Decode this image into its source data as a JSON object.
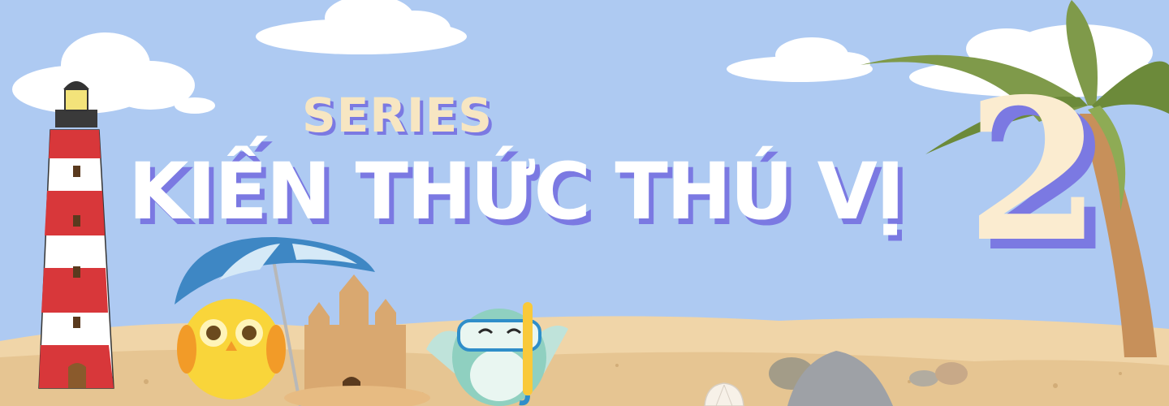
{
  "banner": {
    "series_label": "SERIES",
    "headline": "KIẾN THỨC THÚ VỊ",
    "episode_number": "2"
  },
  "colors": {
    "sky": "#aecaf2",
    "sand": "#e6c592",
    "title_text": "#ffffff",
    "title_shadow": "#7b79e2",
    "series_text": "#f7e6c2",
    "number_fill": "#fbecd0",
    "lighthouse_red": "#d8373a",
    "palm_leaf": "#7f9a4a",
    "umbrella": "#3e87c4",
    "yellow_owl": "#f9d53a",
    "teal_owl": "#8fd0c0"
  },
  "icons": [
    "lighthouse-icon",
    "palm-tree-icon",
    "beach-umbrella-icon",
    "sand-castle-icon",
    "yellow-owl-icon",
    "snorkel-owl-icon",
    "rock-icon",
    "seashell-icon",
    "cloud-icon"
  ]
}
